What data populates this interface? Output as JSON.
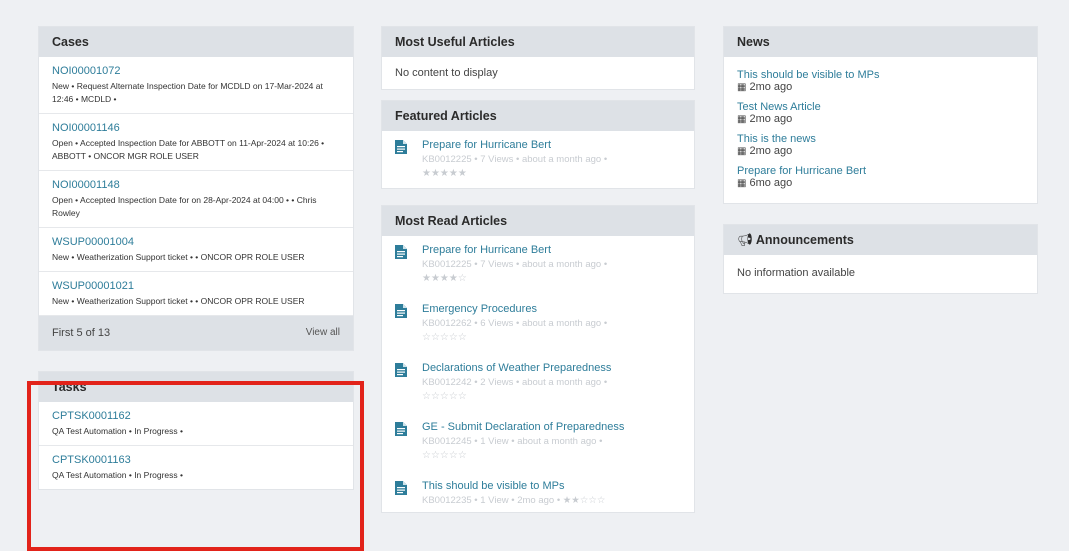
{
  "cases": {
    "title": "Cases",
    "items": [
      {
        "id": "NOI00001072",
        "meta": "New • Request Alternate Inspection Date for MCDLD on 17-Mar-2024 at 12:46 • MCDLD •"
      },
      {
        "id": "NOI00001146",
        "meta": "Open • Accepted Inspection Date for ABBOTT on 11-Apr-2024 at 10:26 • ABBOTT • ONCOR MGR ROLE USER"
      },
      {
        "id": "NOI00001148",
        "meta": "Open • Accepted Inspection Date for on 28-Apr-2024 at 04:00 • • Chris Rowley"
      },
      {
        "id": "WSUP00001004",
        "meta": "New • Weatherization Support ticket • • ONCOR OPR ROLE USER"
      },
      {
        "id": "WSUP00001021",
        "meta": "New • Weatherization Support ticket • • ONCOR OPR ROLE USER"
      }
    ],
    "footer_count": "First 5 of 13",
    "view_all": "View all"
  },
  "tasks": {
    "title": "Tasks",
    "items": [
      {
        "id": "CPTSK0001162",
        "meta": "QA Test Automation • In Progress •"
      },
      {
        "id": "CPTSK0001163",
        "meta": "QA Test Automation • In Progress •"
      }
    ]
  },
  "most_useful": {
    "title": "Most Useful Articles",
    "empty": "No content to display"
  },
  "featured": {
    "title": "Featured Articles",
    "items": [
      {
        "title": "Prepare for Hurricane Bert",
        "meta": "KB0012225  •  7 Views  •  about a month ago  •",
        "stars": "★★★★★"
      }
    ]
  },
  "most_read": {
    "title": "Most Read Articles",
    "items": [
      {
        "title": "Prepare for Hurricane Bert",
        "meta": "KB0012225  •  7 Views  •  about a month ago  •",
        "stars": "★★★★☆"
      },
      {
        "title": "Emergency Procedures",
        "meta": "KB0012262  •  6 Views  •  about a month ago  •",
        "stars": "☆☆☆☆☆"
      },
      {
        "title": "Declarations of Weather Preparedness",
        "meta": "KB0012242  •  2 Views  •  about a month ago  •",
        "stars": "☆☆☆☆☆"
      },
      {
        "title": "GE - Submit Declaration of Preparedness",
        "meta": "KB0012245  •  1 View  •  about a month ago  •",
        "stars": "☆☆☆☆☆"
      },
      {
        "title": "This should be visible to MPs",
        "meta": "KB0012235  •  1 View  •  2mo ago  •  ★★☆☆☆",
        "stars": ""
      }
    ]
  },
  "news": {
    "title": "News",
    "items": [
      {
        "title": "This should be visible to MPs",
        "age": "2mo ago"
      },
      {
        "title": "Test News Article",
        "age": "2mo ago"
      },
      {
        "title": "This is the news",
        "age": "2mo ago"
      },
      {
        "title": "Prepare for Hurricane Bert",
        "age": "6mo ago"
      }
    ]
  },
  "announcements": {
    "title": "Announcements",
    "empty": "No information available"
  },
  "colors": {
    "link": "#2e7d9a",
    "header_bg": "#dde1e6",
    "highlight": "#e2231a"
  }
}
